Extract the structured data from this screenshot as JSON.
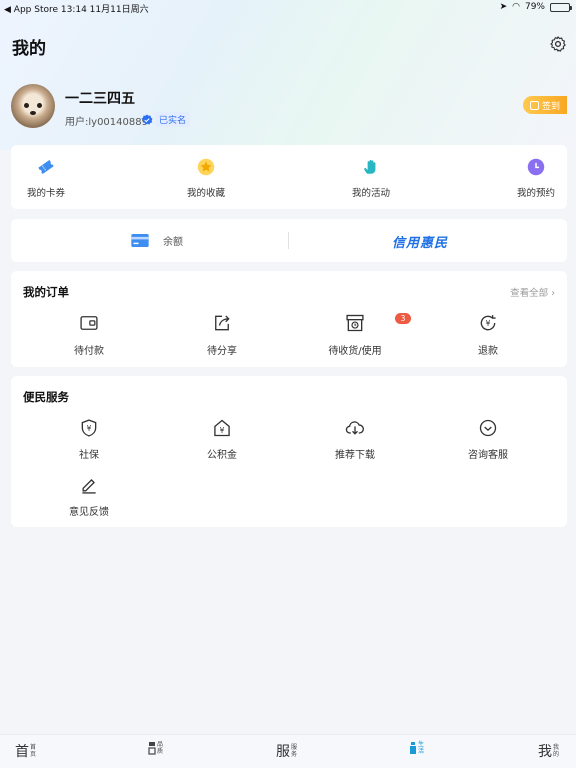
{
  "status_bar": {
    "left": "◀ App Store   13:14   11月11日周六",
    "battery": "79%"
  },
  "header": {
    "title": "我的"
  },
  "profile": {
    "name": "一二三四五",
    "user_id": "用户:ly00140889",
    "verified": "已实名",
    "signin": "签到"
  },
  "quick_links": [
    {
      "label": "我的卡券",
      "icon": "ticket-icon",
      "color": "#3d8ef0"
    },
    {
      "label": "我的收藏",
      "icon": "star-icon",
      "color": "#f7b500"
    },
    {
      "label": "我的活动",
      "icon": "hand-icon",
      "color": "#27b6c2"
    },
    {
      "label": "我的预约",
      "icon": "clock-icon",
      "color": "#8a6ff0"
    }
  ],
  "balance": {
    "label": "余额",
    "credit_logo": "信用惠民"
  },
  "orders": {
    "title": "我的订单",
    "view_all": "查看全部",
    "items": [
      {
        "label": "待付款",
        "icon": "wallet-icon"
      },
      {
        "label": "待分享",
        "icon": "share-icon"
      },
      {
        "label": "待收货/使用",
        "icon": "package-icon",
        "badge": "3"
      },
      {
        "label": "退款",
        "icon": "refund-icon"
      }
    ]
  },
  "services": {
    "title": "便民服务",
    "items": [
      {
        "label": "社保",
        "icon": "shield-yuan-icon"
      },
      {
        "label": "公积金",
        "icon": "house-yuan-icon"
      },
      {
        "label": "推荐下载",
        "icon": "cloud-download-icon"
      },
      {
        "label": "咨询客服",
        "icon": "customer-service-icon"
      },
      {
        "label": "意见反馈",
        "icon": "pen-icon"
      }
    ]
  },
  "tabbar": [
    {
      "big": "首",
      "small": "首页",
      "active": false
    },
    {
      "big": "",
      "small": "品质",
      "active": false
    },
    {
      "big": "服",
      "small": "服务",
      "active": false
    },
    {
      "big": "",
      "small": "生活",
      "active": true
    },
    {
      "big": "我",
      "small": "我的",
      "active": false
    }
  ]
}
